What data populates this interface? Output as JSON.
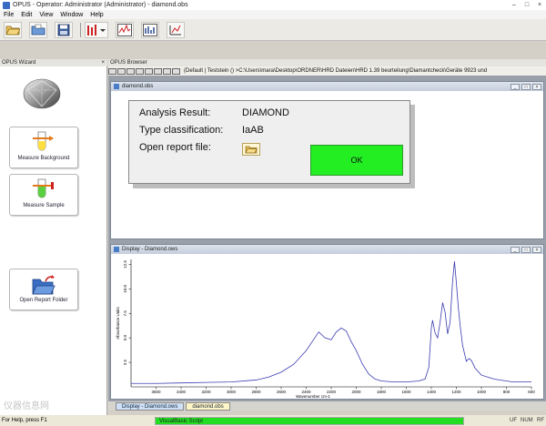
{
  "window": {
    "title": "OPUS - Operator: Administrator  (Administrator) - diamond.obs",
    "controls": [
      "–",
      "□",
      "×"
    ]
  },
  "menu": [
    "File",
    "Edit",
    "View",
    "Window",
    "Help"
  ],
  "toolbar": {
    "buttons": [
      "open-file-icon",
      "load-icon",
      "save-icon",
      "peak-pick-icon",
      "display-spectrum-icon",
      "report-icon",
      "measure-icon"
    ]
  },
  "panels": {
    "wizard_title": "OPUS Wizard",
    "browser_title": "OPUS Browser"
  },
  "wizard": {
    "buttons": [
      {
        "label": "Measure Background"
      },
      {
        "label": "Measure Sample"
      },
      {
        "label": "Open Report Folder"
      }
    ]
  },
  "browser": {
    "path": "(Default | Teststein () >C:\\Users\\mara\\Desktop\\ORDNER\\HRD Dateien\\HRD 1.39 beurteilung\\Diamantcheck\\Geräte 9923 und"
  },
  "obs_window": {
    "title": "diamond.obs",
    "controls": [
      "_",
      "□",
      "×"
    ]
  },
  "dialog": {
    "result_label": "Analysis Result:",
    "result_value": "DIAMOND",
    "type_label": "Type classification:",
    "type_value": "IaAB",
    "report_label": "Open report file:",
    "ok_label": "OK"
  },
  "display_window": {
    "title": "Display - Diamond.ows",
    "controls": [
      "_",
      "□",
      "×"
    ]
  },
  "chart_data": {
    "type": "line",
    "title": "",
    "xlabel": "Wavenumber cm-1",
    "ylabel": "Absorbance Units",
    "xlim": [
      3800,
      600
    ],
    "ylim": [
      0,
      13
    ],
    "x_ticks": [
      3600,
      3400,
      3200,
      3000,
      2800,
      2600,
      2400,
      2200,
      2000,
      1800,
      1600,
      1400,
      1200,
      1000,
      800,
      600
    ],
    "y_ticks": [
      2.5,
      5.0,
      7.5,
      10.0,
      12.5
    ],
    "y_tick_labels": [
      "2.5",
      "5.0",
      "7.5",
      "10.0",
      "12.5"
    ],
    "series": [
      {
        "color": "#3a3ab0",
        "x": [
          3800,
          3600,
          3400,
          3200,
          3000,
          2800,
          2700,
          2600,
          2500,
          2400,
          2300,
          2250,
          2200,
          2160,
          2120,
          2080,
          2040,
          2000,
          1950,
          1900,
          1850,
          1800,
          1700,
          1600,
          1500,
          1450,
          1420,
          1400,
          1390,
          1370,
          1350,
          1330,
          1310,
          1290,
          1270,
          1250,
          1230,
          1215,
          1200,
          1185,
          1170,
          1150,
          1120,
          1100,
          1080,
          1050,
          1000,
          950,
          900,
          850,
          800,
          750,
          700,
          650,
          600
        ],
        "y": [
          0.35,
          0.35,
          0.4,
          0.45,
          0.5,
          0.7,
          1.0,
          1.5,
          2.3,
          3.7,
          5.6,
          5.0,
          4.8,
          5.6,
          6.0,
          5.7,
          4.6,
          3.7,
          2.3,
          1.3,
          0.8,
          0.6,
          0.5,
          0.5,
          0.6,
          0.8,
          2.0,
          6.0,
          6.8,
          5.5,
          5.0,
          6.6,
          8.6,
          7.6,
          5.4,
          6.6,
          10.8,
          12.8,
          10.6,
          8.2,
          6.3,
          4.2,
          2.6,
          2.9,
          2.7,
          1.9,
          1.2,
          1.0,
          0.8,
          0.7,
          0.6,
          0.5,
          0.5,
          0.5,
          0.5
        ]
      }
    ],
    "grid": false
  },
  "doc_tabs": [
    {
      "label": "Display - Diamond.ows",
      "active": false
    },
    {
      "label": "diamond.obs",
      "active": true
    }
  ],
  "status": {
    "help": "For Help, press F1",
    "progress_label": "VisualBasic Script",
    "progress_fraction": 1.0,
    "indicators": [
      "UF",
      "NUM",
      "RF"
    ]
  },
  "watermark": "仪器信息网"
}
